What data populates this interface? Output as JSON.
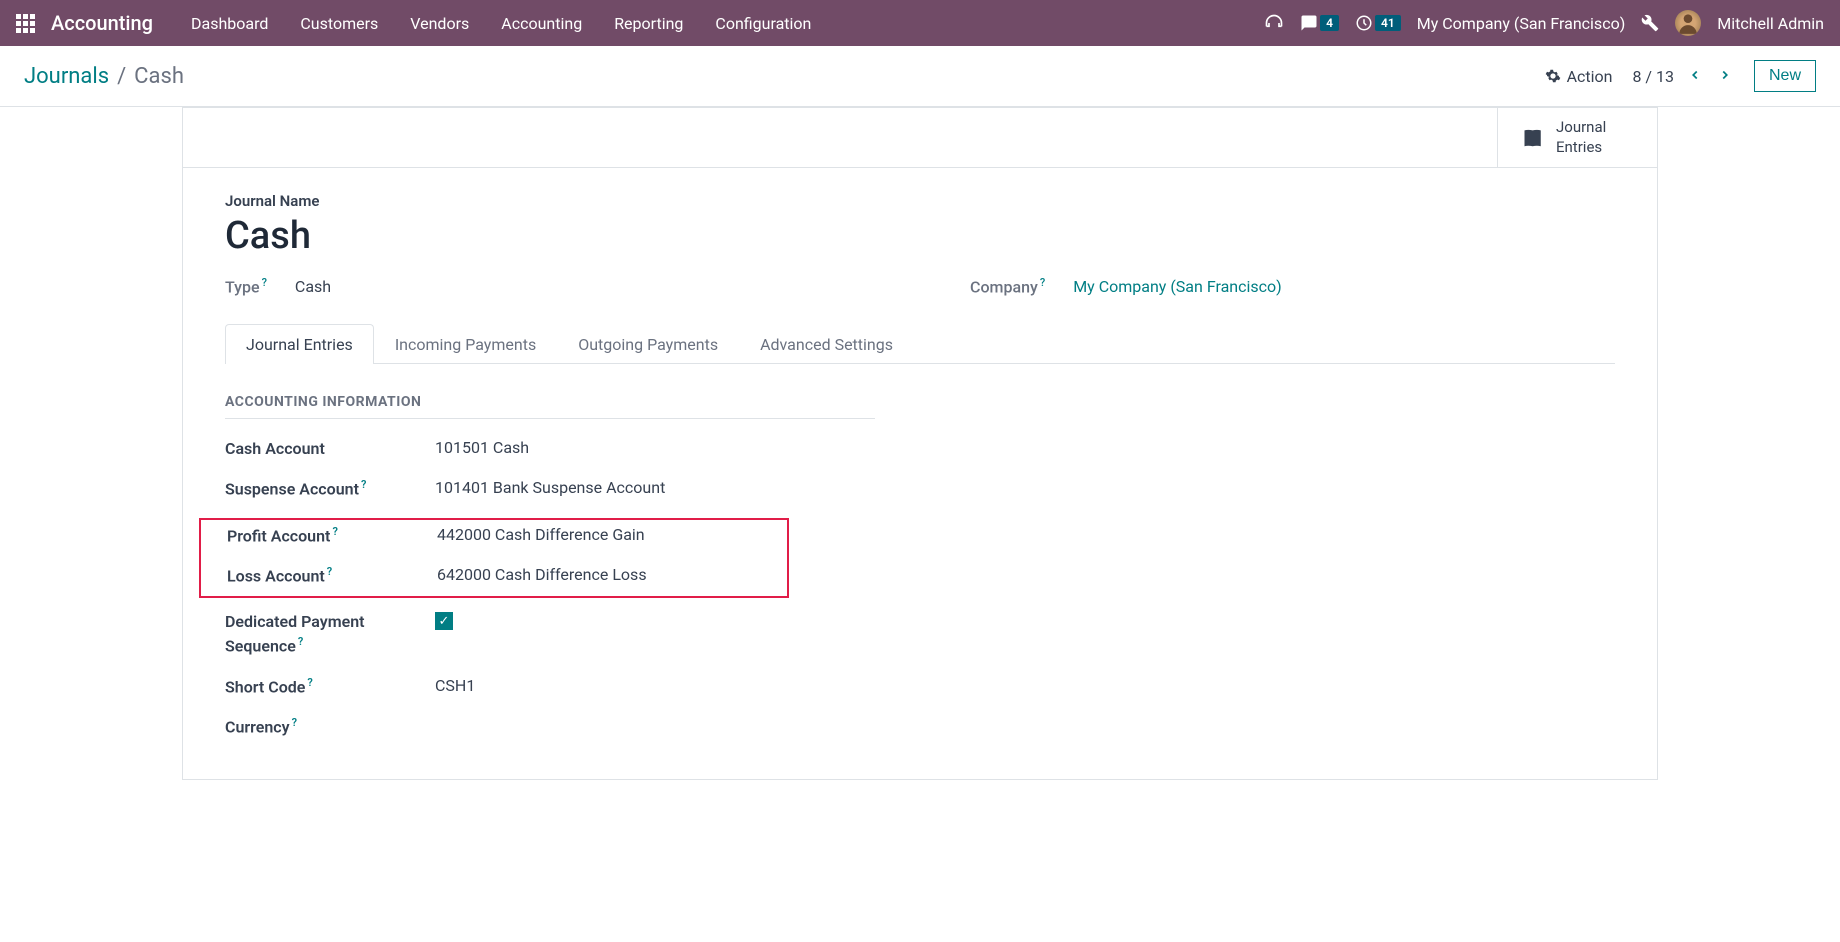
{
  "nav": {
    "app_name": "Accounting",
    "menu": [
      "Dashboard",
      "Customers",
      "Vendors",
      "Accounting",
      "Reporting",
      "Configuration"
    ],
    "messages_badge": "4",
    "activities_badge": "41",
    "company": "My Company (San Francisco)",
    "user": "Mitchell Admin"
  },
  "control": {
    "breadcrumb_parent": "Journals",
    "breadcrumb_current": "Cash",
    "action_label": "Action",
    "pager": "8 / 13",
    "new_button": "New"
  },
  "stat_button": {
    "line1": "Journal",
    "line2": "Entries"
  },
  "form": {
    "name_label": "Journal Name",
    "name_value": "Cash",
    "type_label": "Type",
    "type_value": "Cash",
    "company_label": "Company",
    "company_value": "My Company (San Francisco)"
  },
  "tabs": [
    "Journal Entries",
    "Incoming Payments",
    "Outgoing Payments",
    "Advanced Settings"
  ],
  "section": {
    "title": "ACCOUNTING INFORMATION",
    "cash_account_label": "Cash Account",
    "cash_account_value": "101501 Cash",
    "suspense_label": "Suspense Account",
    "suspense_value": "101401 Bank Suspense Account",
    "profit_label": "Profit Account",
    "profit_value": "442000 Cash Difference Gain",
    "loss_label": "Loss Account",
    "loss_value": "642000 Cash Difference Loss",
    "dedicated_label": "Dedicated Payment Sequence",
    "short_code_label": "Short Code",
    "short_code_value": "CSH1",
    "currency_label": "Currency"
  }
}
